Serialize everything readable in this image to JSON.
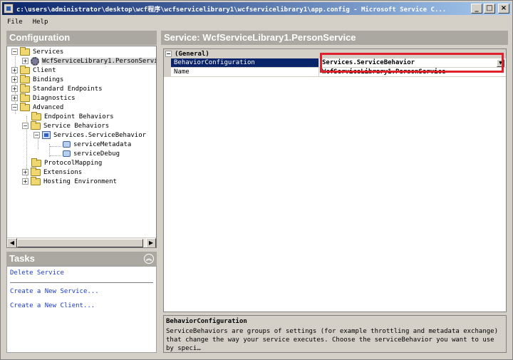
{
  "window": {
    "title": "c:\\users\\administrator\\desktop\\wcf程序\\wcfservicelibrary1\\wcfservicelibrary1\\app.config - Microsoft Service C...",
    "minimize_glyph": "_",
    "maximize_glyph": "□",
    "close_glyph": "×"
  },
  "menu": {
    "items": [
      "File",
      "Help"
    ]
  },
  "configuration": {
    "header": "Configuration",
    "tree": [
      {
        "label": "Services",
        "expander": "−"
      },
      {
        "label": "WcfServiceLibrary1.PersonService",
        "expander": "+"
      },
      {
        "label": "Client",
        "expander": "+"
      },
      {
        "label": "Bindings",
        "expander": "+"
      },
      {
        "label": "Standard Endpoints",
        "expander": "+"
      },
      {
        "label": "Diagnostics",
        "expander": "+"
      },
      {
        "label": "Advanced",
        "expander": "−"
      },
      {
        "label": "Endpoint Behaviors"
      },
      {
        "label": "Service Behaviors",
        "expander": "−"
      },
      {
        "label": "Services.ServiceBehavior",
        "expander": "−"
      },
      {
        "label": "serviceMetadata"
      },
      {
        "label": "serviceDebug"
      },
      {
        "label": "ProtocolMapping"
      },
      {
        "label": "Extensions",
        "expander": "+"
      },
      {
        "label": "Hosting Environment",
        "expander": "+"
      }
    ],
    "scroll_left_glyph": "◀",
    "scroll_right_glyph": "▶"
  },
  "tasks": {
    "header": "Tasks",
    "collapse_glyph": "︽",
    "items": [
      "Delete Service",
      "Create a New Service...",
      "Create a New Client..."
    ]
  },
  "service": {
    "header": "Service: WcfServiceLibrary1.PersonService",
    "category": "(General)",
    "category_expander": "−",
    "properties": [
      {
        "key": "BehaviorConfiguration",
        "value": "Services.ServiceBehavior"
      },
      {
        "key": "Name",
        "value": "WcfServiceLibrary1.PersonService"
      }
    ],
    "dropdown_glyph": "▼"
  },
  "description": {
    "title": "BehaviorConfiguration",
    "text": "ServiceBehaviors are groups of settings (for example throttling and metadata exchange) that change the way your service executes. Choose the serviceBehavior you want to use by speci…"
  },
  "colors": {
    "highlight": "#e0202a",
    "selection": "#0a246a",
    "link": "#1a3cc8"
  }
}
